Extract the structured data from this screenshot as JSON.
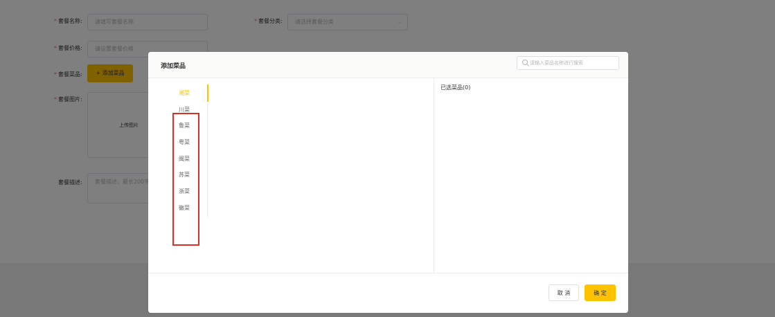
{
  "form": {
    "name_label": "套餐名称:",
    "name_placeholder": "请填写套餐名称",
    "category_label": "套餐分类:",
    "category_placeholder": "请选择套餐分类",
    "price_label": "套餐价格:",
    "price_placeholder": "请设置套餐价格",
    "dishes_label": "套餐菜品:",
    "add_dish_button": "+ 添加菜品",
    "image_label": "套餐图片:",
    "upload_label": "上传图片",
    "desc_label": "套餐描述:",
    "desc_placeholder": "套餐描述，最长200字"
  },
  "dialog": {
    "title": "添加菜品",
    "search_placeholder": "请输入菜品名称进行搜索",
    "categories": [
      "湘菜",
      "川菜",
      "鲁菜",
      "粤菜",
      "闽菜",
      "苏菜",
      "浙菜",
      "徽菜"
    ],
    "active_category_index": 0,
    "selected_label": "已选菜品(0)",
    "cancel_label": "取 消",
    "ok_label": "确 定"
  },
  "colors": {
    "accent": "#ffc200",
    "highlight_border": "#d93025",
    "required": "#f56c6c"
  },
  "icons": {
    "search": "search-icon",
    "select_arrow": "chevron-down-icon"
  }
}
